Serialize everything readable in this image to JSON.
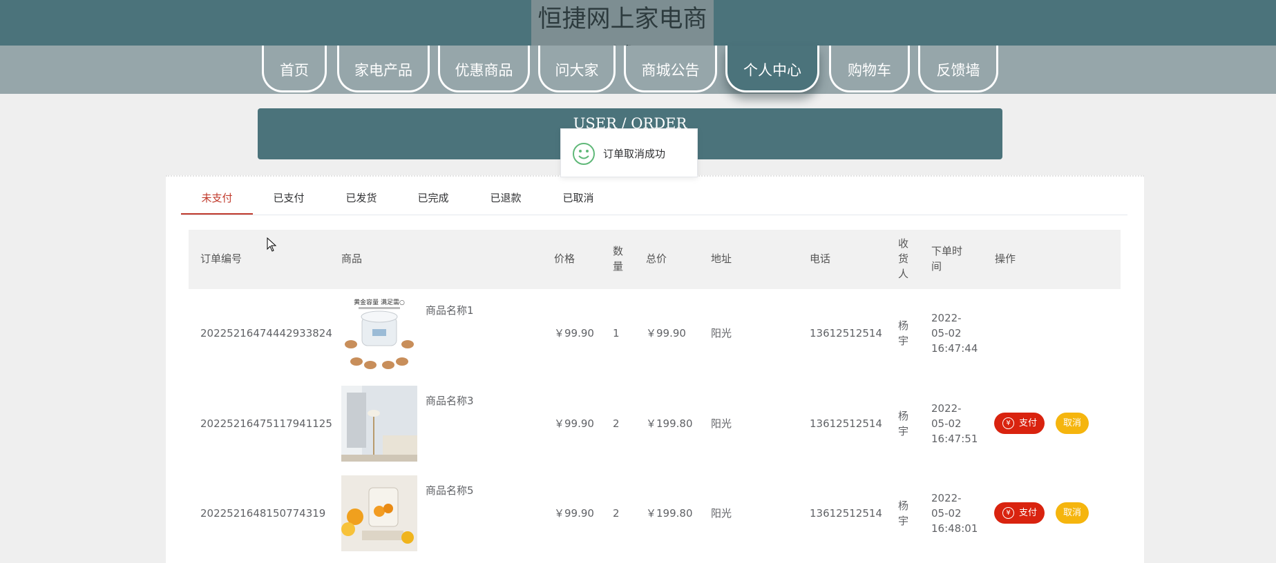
{
  "site": {
    "title": "恒捷网上家电商城"
  },
  "nav": {
    "items": [
      {
        "label": "首页"
      },
      {
        "label": "家电产品"
      },
      {
        "label": "优惠商品"
      },
      {
        "label": "问大家"
      },
      {
        "label": "商城公告"
      },
      {
        "label": "个人中心"
      },
      {
        "label": "购物车"
      },
      {
        "label": "反馈墙"
      }
    ],
    "active": "个人中心"
  },
  "banner": {
    "text": "USER / ORDER"
  },
  "toast": {
    "message": "订单取消成功",
    "icon": "smile-icon"
  },
  "tabs": {
    "items": [
      {
        "label": "未支付"
      },
      {
        "label": "已支付"
      },
      {
        "label": "已发货"
      },
      {
        "label": "已完成"
      },
      {
        "label": "已退款"
      },
      {
        "label": "已取消"
      }
    ],
    "active": "未支付"
  },
  "table": {
    "headers": {
      "order_no": "订单编号",
      "product": "商品",
      "price": "价格",
      "qty_1": "数",
      "qty_2": "量",
      "total": "总价",
      "address": "地址",
      "phone": "电话",
      "receiver_1": "收",
      "receiver_2": "货",
      "receiver_3": "人",
      "time_1": "下单时",
      "time_2": "间",
      "actions": "操作"
    },
    "rows": [
      {
        "order_no": "20225216474442933824",
        "product_name": "商品名称1",
        "price": "￥99.90",
        "qty": "1",
        "total": "￥99.90",
        "address": "阳光",
        "phone": "13612512514",
        "receiver_1": "杨",
        "receiver_2": "宇",
        "time_1": "2022-",
        "time_2": "05-02",
        "time_3": "16:47:44",
        "image_text": "黄金容量 满足需○"
      },
      {
        "order_no": "20225216475117941125",
        "product_name": "商品名称3",
        "price": "￥99.90",
        "qty": "2",
        "total": "￥199.80",
        "address": "阳光",
        "phone": "13612512514",
        "receiver_1": "杨",
        "receiver_2": "宇",
        "time_1": "2022-",
        "time_2": "05-02",
        "time_3": "16:47:51",
        "pay_label": "支付",
        "cancel_label": "取消"
      },
      {
        "order_no": "2022521648150774319",
        "product_name": "商品名称5",
        "price": "￥99.90",
        "qty": "2",
        "total": "￥199.80",
        "address": "阳光",
        "phone": "13612512514",
        "receiver_1": "杨",
        "receiver_2": "宇",
        "time_1": "2022-",
        "time_2": "05-02",
        "time_3": "16:48:01",
        "pay_label": "支付",
        "cancel_label": "取消"
      }
    ]
  },
  "colors": {
    "header": "#4b737b",
    "nav_band": "#96a6aa",
    "pay_button": "#d9230f",
    "cancel_button": "#f5b50e",
    "active_tab": "#c0392b"
  }
}
